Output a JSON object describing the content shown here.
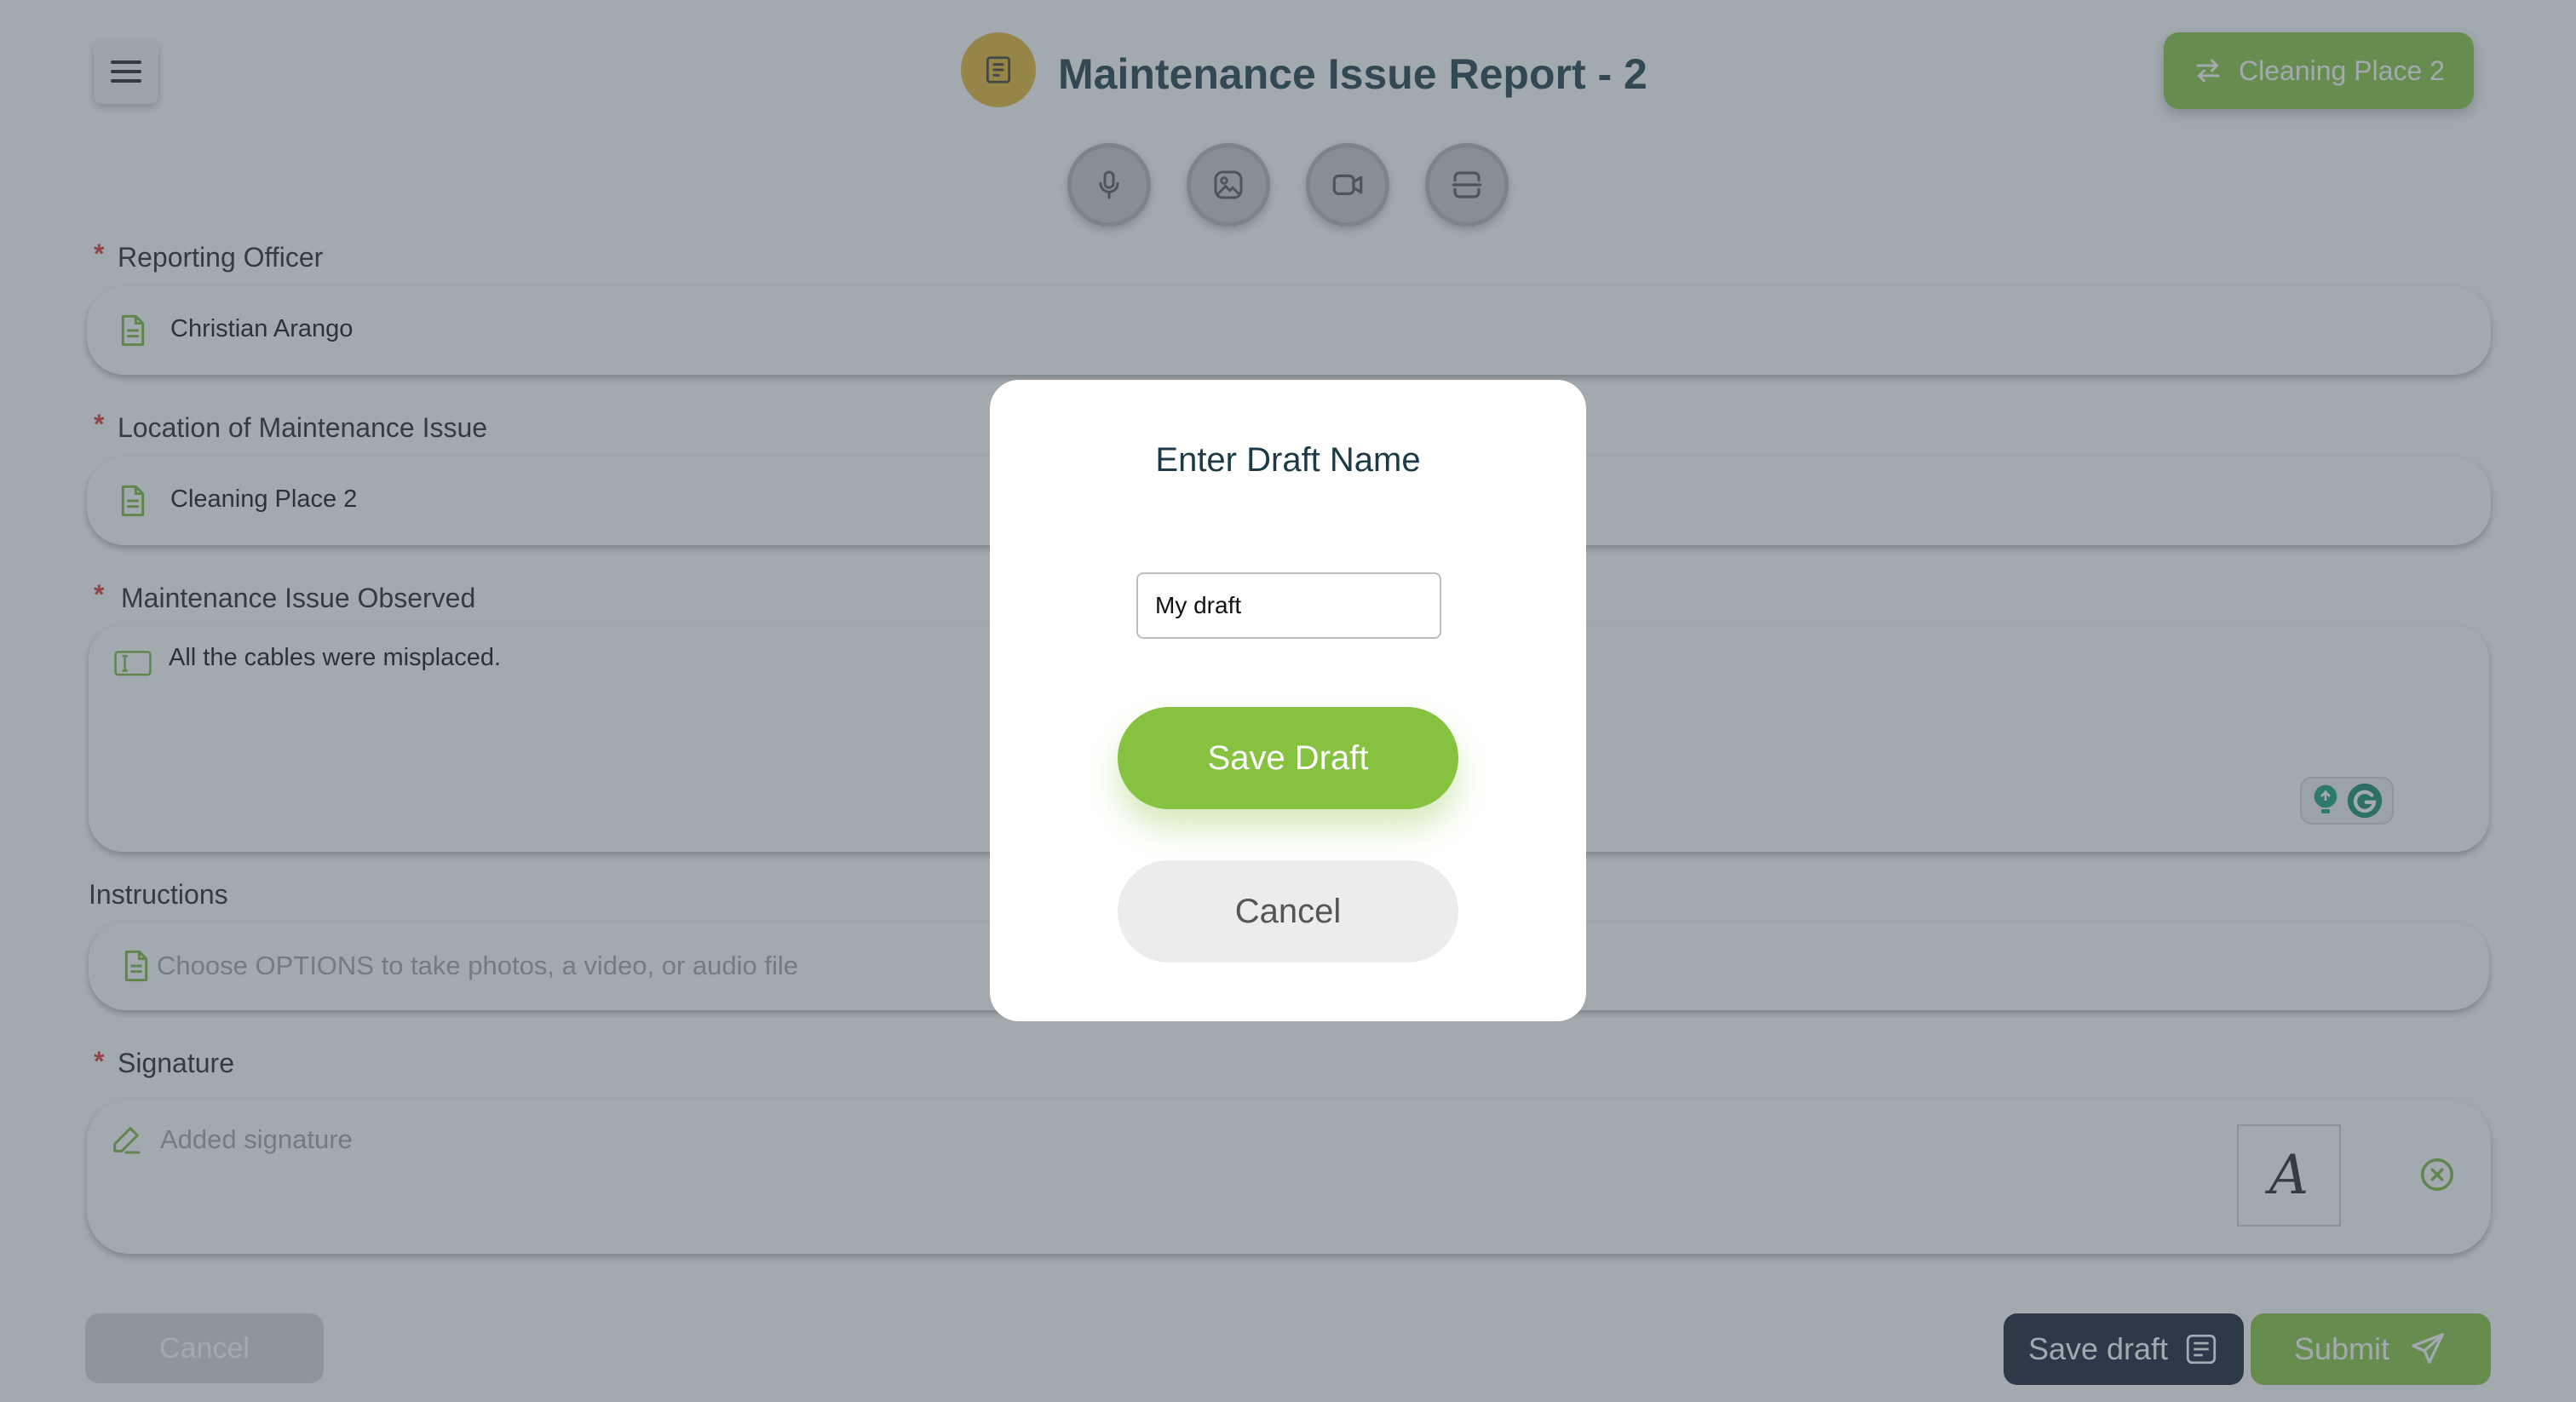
{
  "header": {
    "title": "Maintenance Issue Report - 2",
    "location_button": "Cleaning Place 2",
    "icons": {
      "menu": "hamburger-menu-icon",
      "form": "form-document-icon",
      "swap": "swap-arrows-icon"
    }
  },
  "media_buttons": [
    {
      "icon": "microphone-icon"
    },
    {
      "icon": "image-icon"
    },
    {
      "icon": "video-camera-icon"
    },
    {
      "icon": "options-icon"
    }
  ],
  "fields": {
    "reporting_officer": {
      "label": "Reporting Officer",
      "value": "Christian Arango"
    },
    "location": {
      "label": "Location of Maintenance Issue",
      "value": "Cleaning Place 2"
    },
    "issue_observed": {
      "label": "Maintenance Issue Observed",
      "value": "All the cables were misplaced."
    },
    "instructions": {
      "label": "Instructions",
      "placeholder": "Choose OPTIONS to take photos, a video, or audio file"
    },
    "signature": {
      "label": "Signature",
      "placeholder": "Added signature",
      "signature_mark": "A"
    }
  },
  "required_mark": "*",
  "footer": {
    "cancel_label": "Cancel",
    "save_draft_label": "Save draft",
    "submit_label": "Submit"
  },
  "modal": {
    "title": "Enter Draft Name",
    "input_value": "My draft",
    "save_label": "Save Draft",
    "cancel_label": "Cancel"
  },
  "colors": {
    "accent_green": "#86c240",
    "title_dark": "#1c3a46",
    "header_icon_gold": "#e2b530",
    "save_draft_navy": "#121a33",
    "required_red": "#e0322b"
  }
}
